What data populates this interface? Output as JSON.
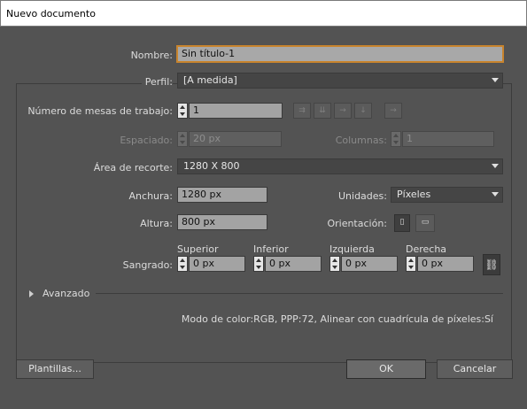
{
  "window": {
    "title": "Nuevo documento"
  },
  "name": {
    "label": "Nombre:",
    "value": "Sin título-1"
  },
  "profile": {
    "label": "Perfil:",
    "value": "[A medida]"
  },
  "artboards": {
    "label": "Número de mesas de trabajo:",
    "value": "1"
  },
  "spacing": {
    "label": "Espaciado:",
    "value": "20 px"
  },
  "columns": {
    "label": "Columnas:",
    "value": "1"
  },
  "crop_area": {
    "label": "Área de recorte:",
    "value": "1280 X 800"
  },
  "width": {
    "label": "Anchura:",
    "value": "1280 px"
  },
  "units": {
    "label": "Unidades:",
    "value": "Píxeles"
  },
  "height": {
    "label": "Altura:",
    "value": "800 px"
  },
  "orientation": {
    "label": "Orientación:"
  },
  "bleed": {
    "label": "Sangrado:",
    "top": {
      "label": "Superior",
      "value": "0 px"
    },
    "bottom": {
      "label": "Inferior",
      "value": "0 px"
    },
    "left": {
      "label": "Izquierda",
      "value": "0 px"
    },
    "right": {
      "label": "Derecha",
      "value": "0 px"
    }
  },
  "advanced": {
    "label": "Avanzado"
  },
  "summary": "Modo de color:RGB, PPP:72, Alinear con cuadrícula de píxeles:Sí",
  "buttons": {
    "templates": "Plantillas...",
    "ok": "OK",
    "cancel": "Cancelar"
  }
}
